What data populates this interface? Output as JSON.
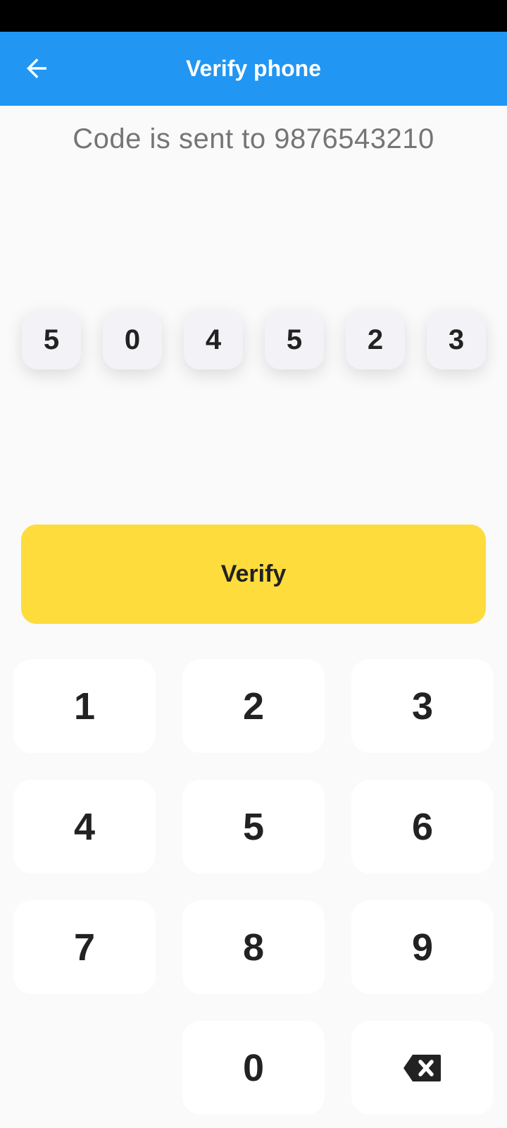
{
  "header": {
    "title": "Verify phone",
    "back_icon": "arrow-left-icon",
    "background": "#2196f3"
  },
  "subtitle": "Code is sent to 9876543210",
  "otp": {
    "digits": [
      "5",
      "0",
      "4",
      "5",
      "2",
      "3"
    ]
  },
  "verify_button": {
    "label": "Verify",
    "color": "#fddc3c"
  },
  "keypad": {
    "keys": [
      "1",
      "2",
      "3",
      "4",
      "5",
      "6",
      "7",
      "8",
      "9",
      "0"
    ],
    "backspace_icon": "backspace-icon"
  }
}
